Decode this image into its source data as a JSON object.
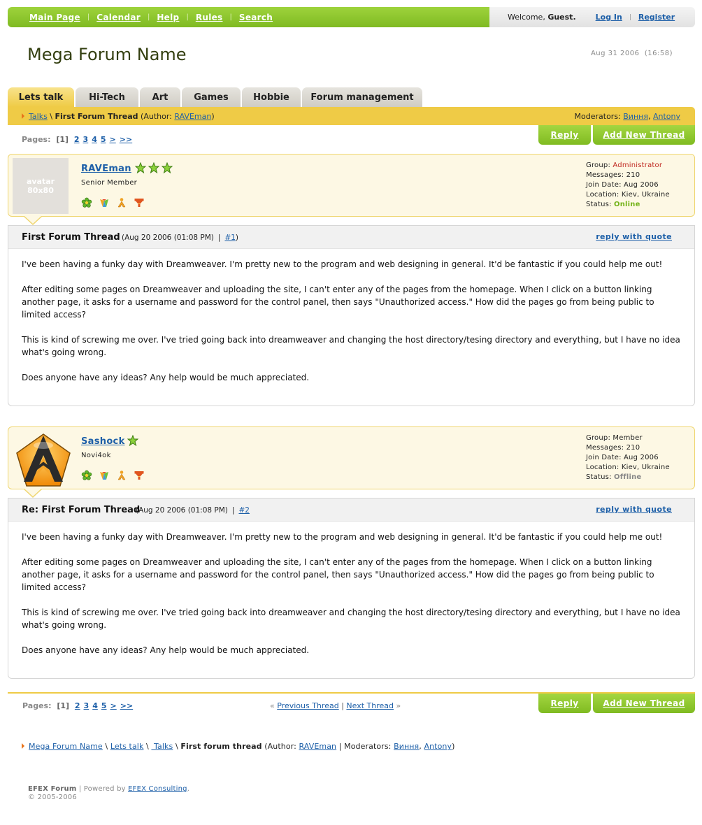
{
  "nav": {
    "items": [
      "Main Page",
      "Calendar",
      "Help",
      "Rules",
      "Search"
    ],
    "welcome_prefix": "Welcome, ",
    "welcome_user": "Guest.",
    "login": "Log In",
    "register": "Register"
  },
  "site": {
    "title": "Mega Forum Name",
    "date": "Aug 31 2006  (16:58)"
  },
  "tabs": [
    "Lets talk",
    "Hi-Tech",
    "Art",
    "Games",
    "Hobbie",
    "Forum management"
  ],
  "breadcrumb": {
    "section": "Talks",
    "sep": " \\ ",
    "thread": "First Forum Thread",
    "author_prefix": " (Author: ",
    "author": "RAVEman",
    "author_suffix": ")",
    "moderators_label": "Moderators: ",
    "moderators": [
      "Виння",
      "Antony"
    ]
  },
  "pagination": {
    "label": "Pages:",
    "current": "[1]",
    "pages": [
      "2",
      "3",
      "4",
      "5",
      ">",
      ">>"
    ]
  },
  "buttons": {
    "reply": "Reply",
    "new_thread": "Add New Thread"
  },
  "posts": [
    {
      "username": "RAVEman",
      "stars": 3,
      "rank": "Senior Member",
      "avatar_text": "avatar 80x80",
      "group_label": "Group: ",
      "group": "Administrator",
      "messages": "Messages: 210",
      "join": "Join Date: Aug 2006",
      "location": "Location: Kiev, Ukraine",
      "status_label": "Status: ",
      "status": "Online",
      "title": "First Forum Thread",
      "date": "(Aug 20 2006 (01:08 PM)",
      "num": "#1",
      "num_suffix": ")",
      "quote": "reply with quote",
      "body": [
        "I've been having a funky day with Dreamweaver. I'm pretty new to the program and web designing in general. It'd be fantastic if you could help me out!",
        "After editing some pages on Dreamweaver and uploading the site, I can't enter any of the pages from the homepage. When I click on a button linking another page, it asks for a username and password for the control panel, then says \"Unauthorized access.\" How did the pages go from being public to limited access?",
        "This is kind of screwing me over. I've tried going back into dreamweaver and changing the host directory/tesing directory and everything, but I have no idea what's going wrong.",
        "Does anyone have any ideas? Any help would be much appreciated."
      ]
    },
    {
      "username": "Sashock",
      "stars": 1,
      "rank": "Novi4ok",
      "group_label": "Group: ",
      "group": "Member",
      "messages": "Messages: 210",
      "join": "Join Date: Aug 2006",
      "location": "Location: Kiev, Ukraine",
      "status_label": "Status: ",
      "status": "Offline",
      "title": "Re: First Forum Thread",
      "date": "(Aug 20 2006 (01:08 PM)",
      "num": "#2",
      "num_suffix": "",
      "quote": "reply with quote",
      "body": [
        "I've been having a funky day with Dreamweaver. I'm pretty new to the program and web designing in general. It'd be fantastic if you could help me out!",
        "After editing some pages on Dreamweaver and uploading the site, I can't enter any of the pages from the homepage. When I click on a button linking another page, it asks for a username and password for the control panel, then says \"Unauthorized access.\" How did the pages go from being public to limited access?",
        "This is kind of screwing me over. I've tried going back into dreamweaver and changing the host directory/tesing directory and everything, but I have no idea what's going wrong.",
        "Does anyone have any ideas? Any help would be much appreciated."
      ]
    }
  ],
  "thread_nav": {
    "prev": "Previous Thread",
    "next": "Next Thread",
    "prev_mark": "«",
    "next_mark": "»",
    "sep": "|"
  },
  "footer_crumb": {
    "forum": "Mega Forum Name",
    "category": "Lets talk",
    "section": " Talks",
    "thread": "First forum thread",
    "author_prefix": " (Author: ",
    "author": "RAVEman",
    "mods_prefix": " | Moderators: ",
    "moderators": [
      "Виння",
      "Antony"
    ],
    "end": ")"
  },
  "copyright": {
    "brand": "EFEX Forum",
    "powered": " | Powered by ",
    "company": "EFEX Consulting",
    "dot": ".",
    "years": "© 2005-2006"
  },
  "colors": {
    "green": "#7fba22",
    "yellow": "#efcb46",
    "link": "#1d5fa8",
    "admin": "#c02a22",
    "online": "#74b31a"
  }
}
